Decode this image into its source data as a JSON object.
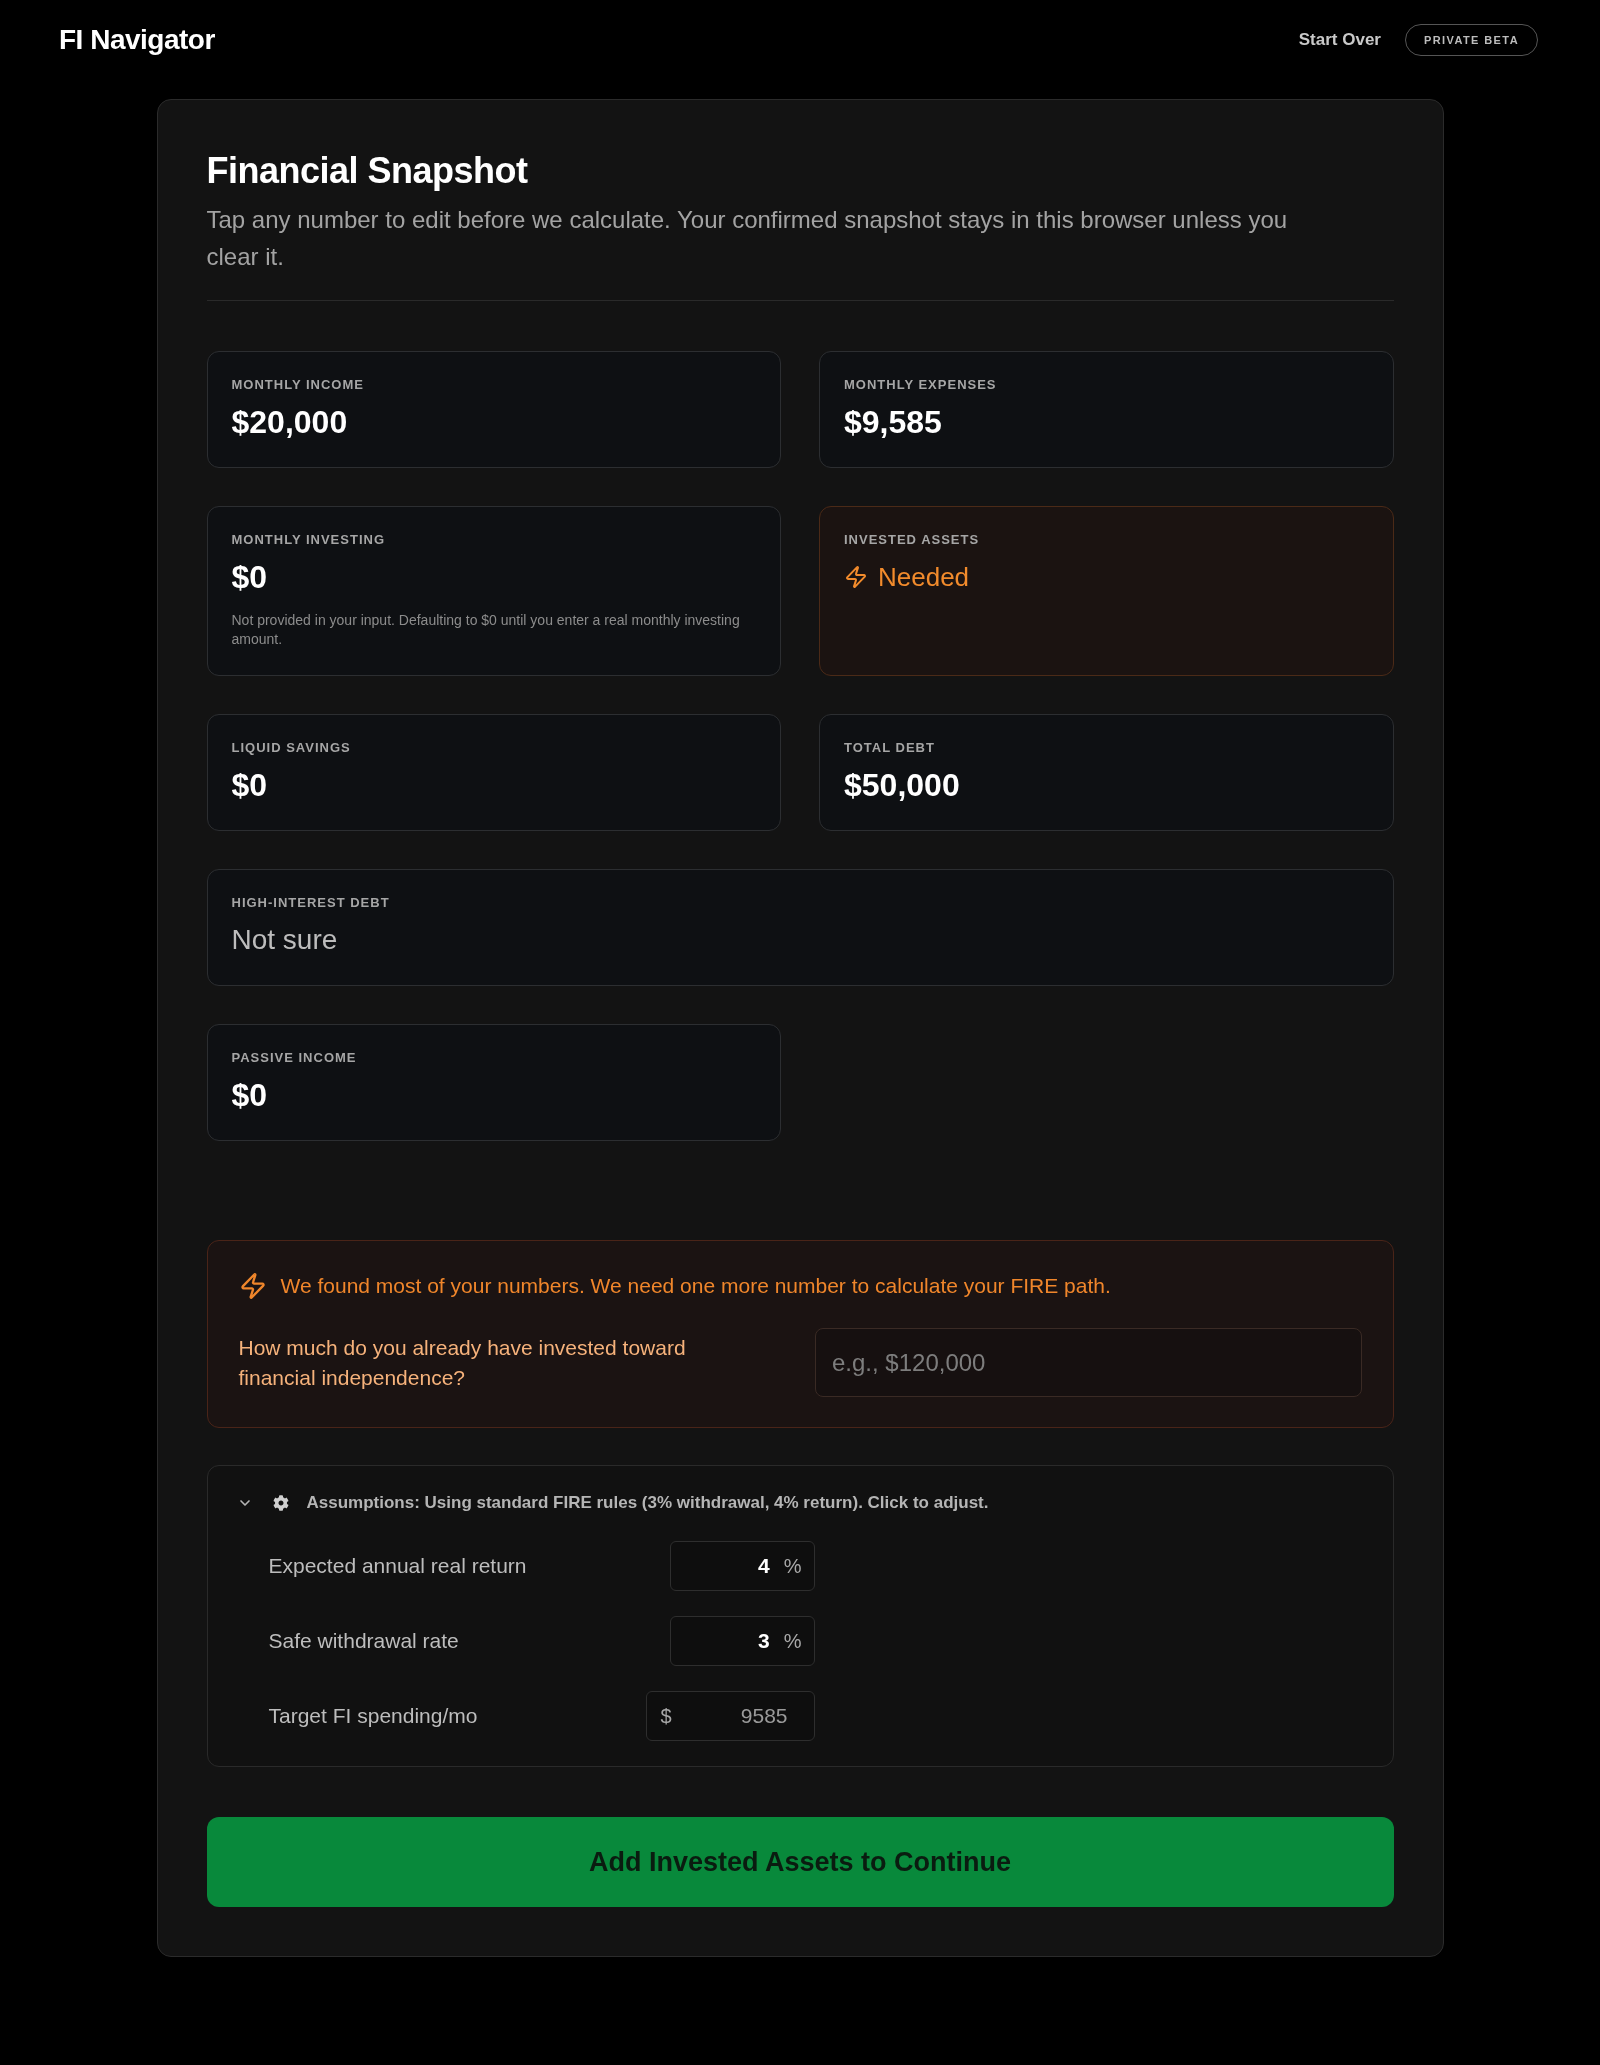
{
  "header": {
    "logo": "FI Navigator",
    "link": "Start Over",
    "badge": "PRIVATE BETA"
  },
  "snapshot": {
    "title": "Financial Snapshot",
    "subtitle": "Tap any number to edit before we calculate. Your confirmed snapshot stays in this browser unless you clear it.",
    "fields": [
      {
        "kind": "amount",
        "label": "MONTHLY INCOME",
        "value": "$20,000"
      },
      {
        "kind": "amount",
        "label": "MONTHLY EXPENSES",
        "value": "$9,585"
      },
      {
        "kind": "amount",
        "label": "MONTHLY INVESTING",
        "value": "$0",
        "note": "Not provided in your input. Defaulting to $0 until you enter a real monthly investing amount."
      },
      {
        "kind": "missing",
        "label": "INVESTED ASSETS",
        "value": "Needed"
      },
      {
        "kind": "amount",
        "label": "LIQUID SAVINGS",
        "value": "$0"
      },
      {
        "kind": "amount",
        "label": "TOTAL DEBT",
        "value": "$50,000"
      },
      {
        "kind": "choice",
        "label": "HIGH-INTEREST DEBT",
        "value": "Not sure"
      },
      {
        "kind": "amount",
        "label": "PASSIVE INCOME",
        "value": "$0"
      }
    ]
  },
  "missing_prompt": {
    "message": "We found most of your numbers. We need one more number to calculate your FIRE path.",
    "question": "How much do you already have invested toward financial independence?",
    "input": {
      "placeholder": "e.g., $120,000"
    }
  },
  "assumptions": {
    "expanded": true,
    "summary": "Assumptions: Using standard FIRE rules (3% withdrawal, 4% return). Click to adjust.",
    "rows": [
      {
        "label": "Expected annual real return",
        "value": "4",
        "suffix": "%"
      },
      {
        "label": "Safe withdrawal rate",
        "value": "3",
        "suffix": "%"
      },
      {
        "label": "Target FI spending/mo",
        "prefix": "$",
        "placeholder": "9585"
      }
    ]
  },
  "primary_button": {
    "label": "Add Invested Assets to Continue"
  }
}
